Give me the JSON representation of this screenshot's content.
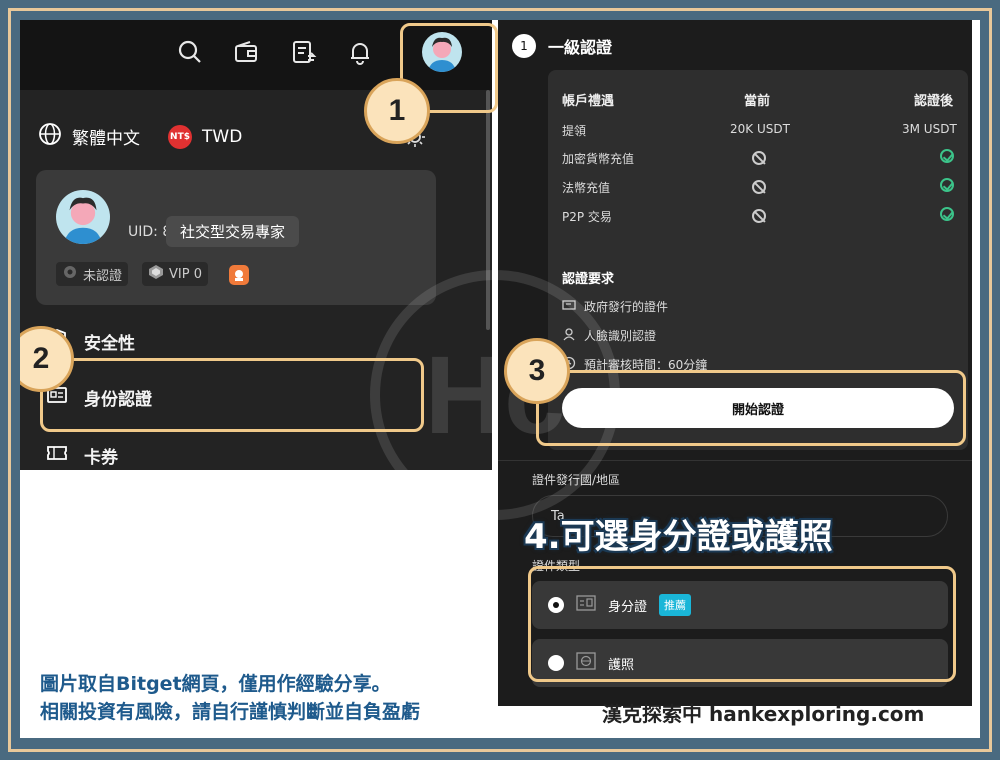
{
  "header": {
    "icons": [
      "search-icon",
      "wallet-icon",
      "orders-icon",
      "bell-icon",
      "avatar"
    ]
  },
  "annotations": {
    "step1": "1",
    "step2": "2",
    "step3": "3",
    "step4": "4.可選身分證或護照"
  },
  "left_menu": {
    "language": "繁體中文",
    "currency_badge": "NT$",
    "currency": "TWD",
    "uid_label": "UID: 8",
    "tooltip": "社交型交易專家",
    "status_unverified": "未認證",
    "vip": "VIP 0",
    "items": [
      {
        "label": "安全性"
      },
      {
        "label": "身份認證"
      },
      {
        "label": "卡券"
      }
    ]
  },
  "verification": {
    "step_number": "1",
    "title": "一級認證",
    "columns": [
      "帳戶禮遇",
      "當前",
      "認證後"
    ],
    "rows": [
      {
        "name": "提領",
        "current": "20K USDT",
        "after": "3M USDT"
      },
      {
        "name": "加密貨幣充值",
        "current": "ban",
        "after": "check"
      },
      {
        "name": "法幣充值",
        "current": "ban",
        "after": "check"
      },
      {
        "name": "P2P 交易",
        "current": "ban",
        "after": "check"
      }
    ],
    "requirements_title": "認證要求",
    "requirements": [
      "政府發行的證件",
      "人臉識別認證",
      "預計審核時間：60分鐘"
    ],
    "start_button": "開始認證",
    "country_label": "證件發行國/地區",
    "country_value": "Ta",
    "doc_type_label": "證件類型",
    "doc_options": [
      {
        "label": "身分證",
        "tag": "推薦",
        "selected": true
      },
      {
        "label": "護照",
        "selected": false
      }
    ]
  },
  "footer": {
    "disclaimer_line1": "圖片取自Bitget網頁，僅用作經驗分享。",
    "disclaimer_line2": "相關投資有風險，請自行謹慎判斷並自負盈虧",
    "brand": "漢克探索中 hankexploring.com"
  },
  "colors": {
    "highlight": "#f0c98a",
    "badge_bg": "#fbe3bb",
    "success": "#3cc48a",
    "recommend": "#1ab6d8",
    "frame": "#4a6a80"
  }
}
